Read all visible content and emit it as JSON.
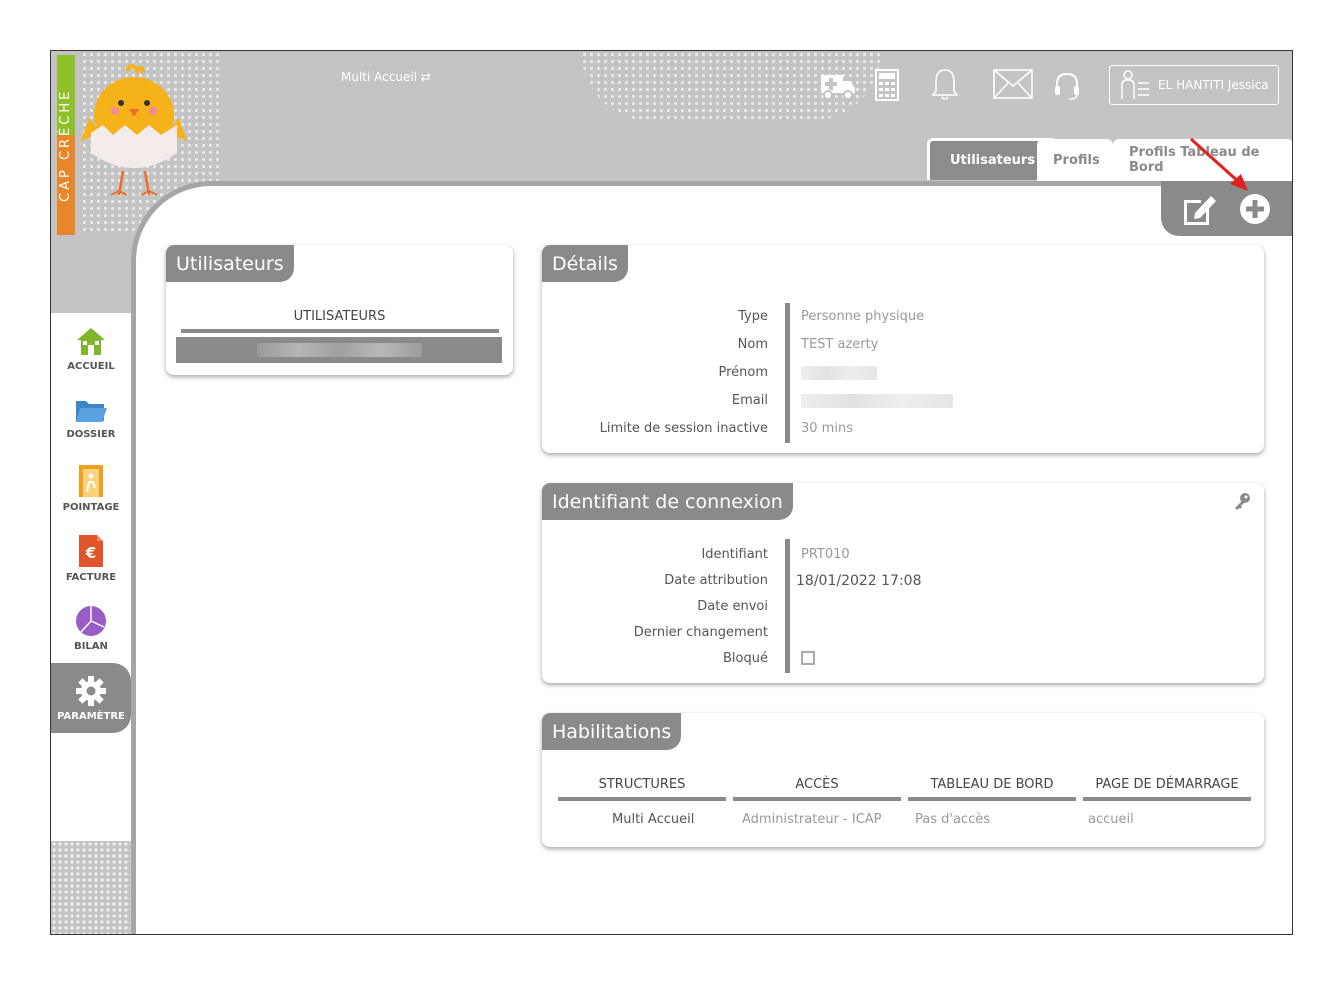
{
  "brand": {
    "letters": "CAP CRÈCHE"
  },
  "header": {
    "site_switch": "Multi Accueil ⇄",
    "user_name": "EL HANTITI Jessica"
  },
  "tabs": [
    {
      "label": "Utilisateurs",
      "active": true
    },
    {
      "label": "Profils",
      "active": false
    },
    {
      "label": "Profils Tableau de Bord",
      "active": false
    }
  ],
  "nav": {
    "items": [
      {
        "label": "ACCUEIL",
        "icon": "house-icon"
      },
      {
        "label": "DOSSIER",
        "icon": "folder-icon"
      },
      {
        "label": "POINTAGE",
        "icon": "door-icon"
      },
      {
        "label": "FACTURE",
        "icon": "euro-document-icon"
      },
      {
        "label": "BILAN",
        "icon": "pie-chart-icon"
      },
      {
        "label": "PARAMÈTRE",
        "icon": "gear-icon"
      }
    ]
  },
  "users_panel": {
    "title": "Utilisateurs",
    "column": "UTILISATEURS"
  },
  "details": {
    "title": "Détails",
    "rows": [
      {
        "label": "Type",
        "value": "Personne physique"
      },
      {
        "label": "Nom",
        "value": "TEST azerty"
      },
      {
        "label": "Prénom",
        "value": ""
      },
      {
        "label": "Email",
        "value": ""
      },
      {
        "label": "Limite de session inactive",
        "value": "30 mins"
      }
    ]
  },
  "login": {
    "title": "Identifiant de connexion",
    "rows": [
      {
        "label": "Identifiant",
        "value": "PRT010"
      },
      {
        "label": "Date attribution",
        "value": "18/01/2022 17:08"
      },
      {
        "label": "Date envoi",
        "value": ""
      },
      {
        "label": "Dernier changement",
        "value": ""
      },
      {
        "label": "Bloqué",
        "value": ""
      }
    ]
  },
  "habilitations": {
    "title": "Habilitations",
    "headers": [
      "STRUCTURES",
      "ACCÈS",
      "TABLEAU DE BORD",
      "PAGE DE DÉMARRAGE"
    ],
    "row": [
      "Multi Accueil",
      "Administrateur - ICAP",
      "Pas d'accès",
      "accueil"
    ]
  },
  "colors": {
    "header_bg": "#c4c4c4",
    "panel_title_bg": "#8a8a8a",
    "arrow": "#e0211f"
  }
}
